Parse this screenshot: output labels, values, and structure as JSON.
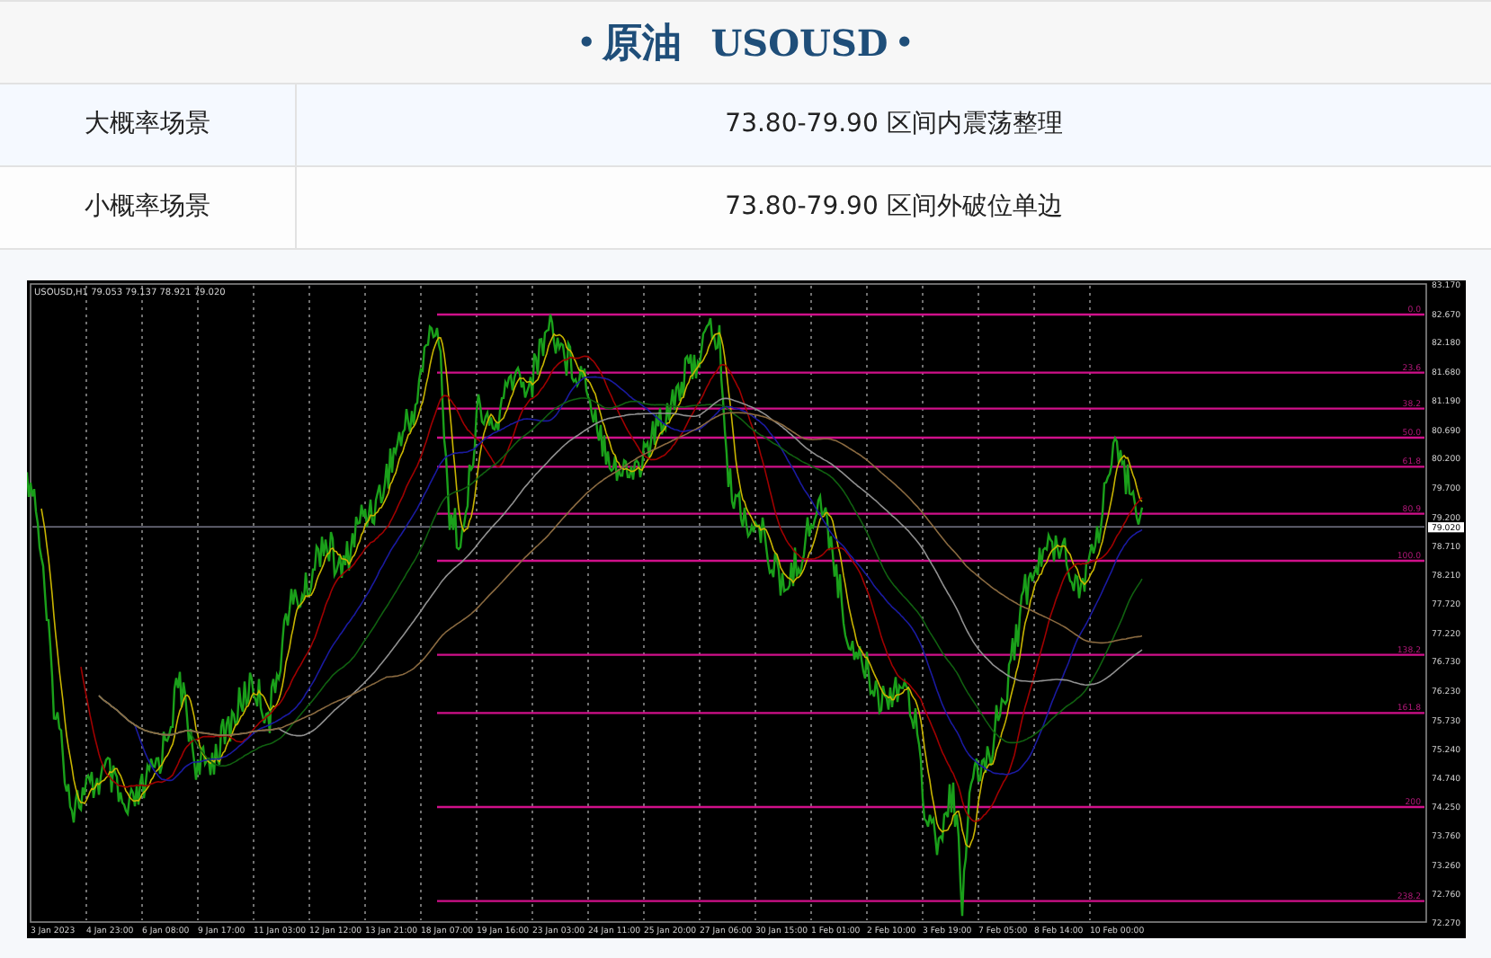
{
  "title": {
    "bullet_left": "•",
    "name": "原油",
    "symbol": "USOUSD",
    "bullet_right": "•"
  },
  "rows": [
    {
      "label": "大概率场景",
      "value": "73.80-79.90 区间内震荡整理"
    },
    {
      "label": "小概率场景",
      "value": "73.80-79.90 区间外破位单边"
    }
  ],
  "chart": {
    "header": "USOUSD,H1  79.053 79.137 78.921 79.020",
    "price_labels": [
      "83.170",
      "82.670",
      "82.180",
      "81.680",
      "81.190",
      "80.690",
      "80.200",
      "79.700",
      "79.200",
      "78.710",
      "78.210",
      "77.720",
      "77.220",
      "76.730",
      "76.230",
      "75.730",
      "75.240",
      "74.740",
      "74.250",
      "73.760",
      "73.260",
      "72.760",
      "72.270"
    ],
    "current_price": "79.020",
    "fib_levels": [
      "0.0",
      "23.6",
      "38.2",
      "50.0",
      "61.8",
      "80.9",
      "100.0",
      "138.2",
      "161.8",
      "200",
      "238.2"
    ],
    "time_labels": [
      "3 Jan 2023",
      "4 Jan 23:00",
      "6 Jan 08:00",
      "9 Jan 17:00",
      "11 Jan 03:00",
      "12 Jan 12:00",
      "13 Jan 21:00",
      "18 Jan 07:00",
      "19 Jan 16:00",
      "23 Jan 03:00",
      "24 Jan 11:00",
      "25 Jan 20:00",
      "27 Jan 06:00",
      "30 Jan 15:00",
      "1 Feb 01:00",
      "2 Feb 10:00",
      "3 Feb 19:00",
      "7 Feb 05:00",
      "8 Feb 14:00",
      "10 Feb 00:00"
    ]
  }
}
